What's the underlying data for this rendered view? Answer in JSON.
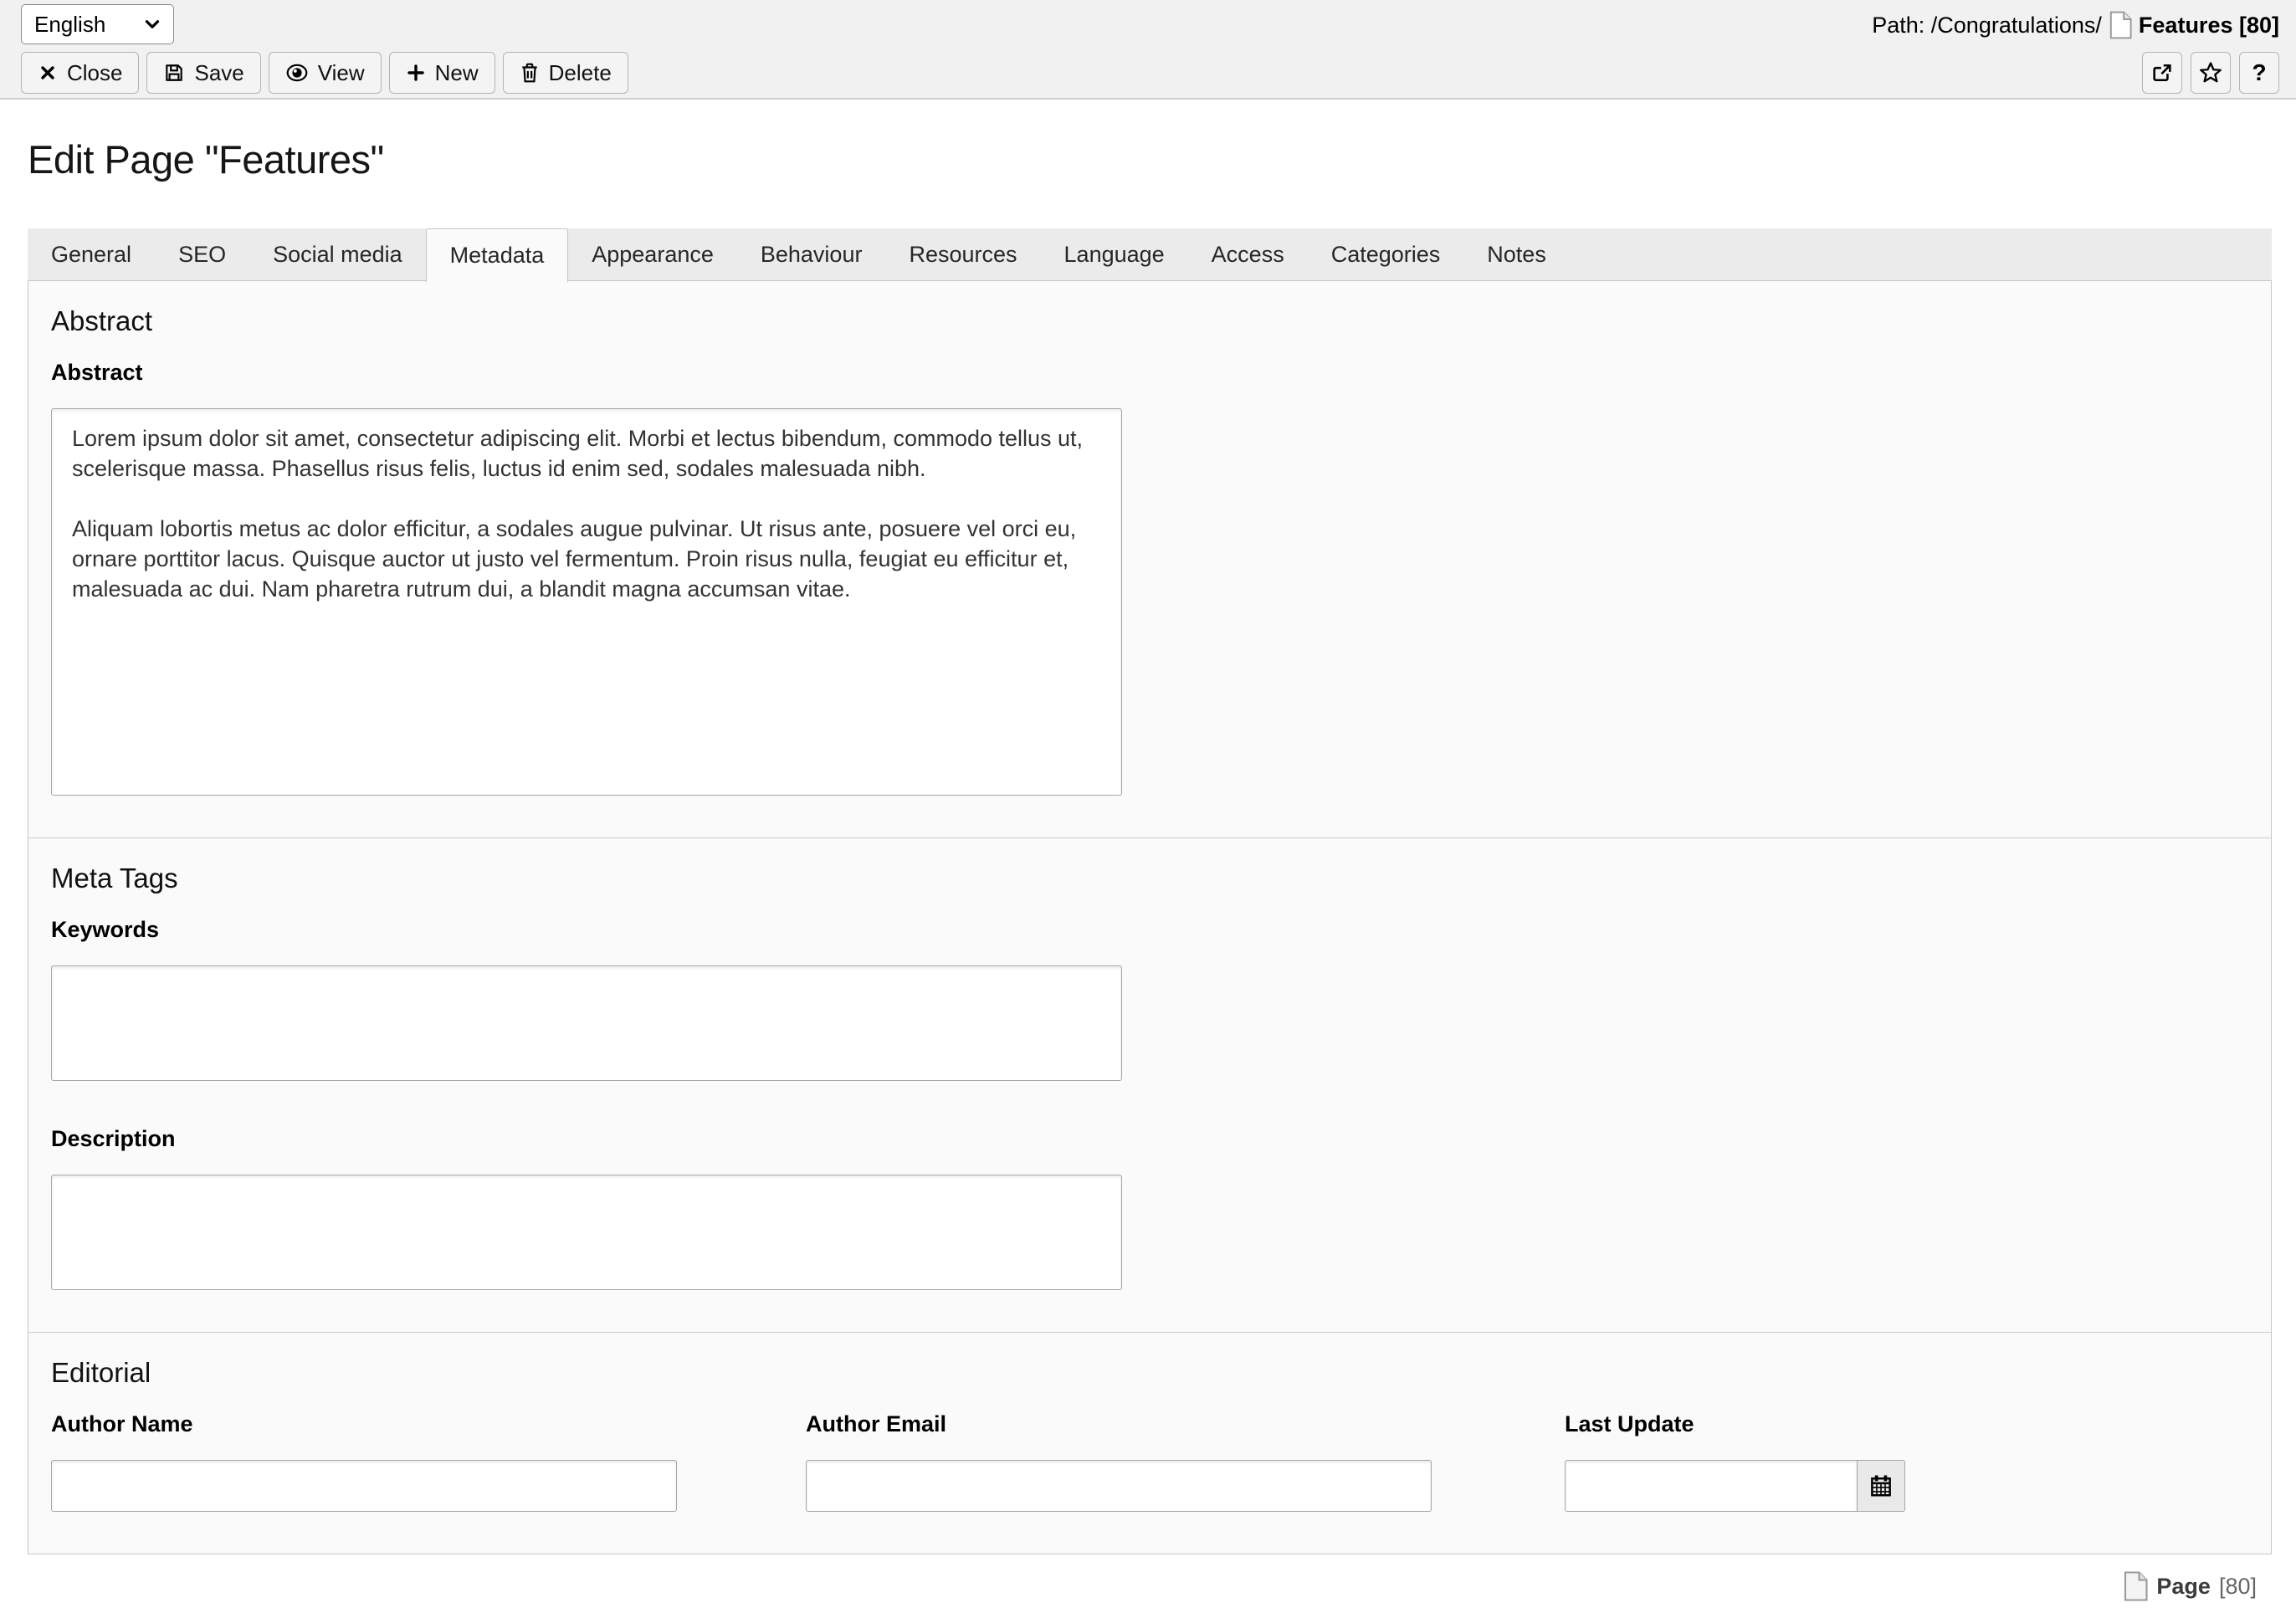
{
  "colors": {
    "toolbar_bg": "#f1f1f1",
    "panel_bg": "#fafafa",
    "border": "#c6c6c6"
  },
  "language_bar": {
    "selected_language": "English"
  },
  "toolbar": {
    "buttons": [
      {
        "label": "Close",
        "icon": "close-icon"
      },
      {
        "label": "Save",
        "icon": "save-icon"
      },
      {
        "label": "View",
        "icon": "view-icon"
      },
      {
        "label": "New",
        "icon": "new-icon"
      },
      {
        "label": "Delete",
        "icon": "delete-icon"
      }
    ]
  },
  "header": {
    "path_label": "Path: /Congratulations/",
    "record_icon": "page-icon",
    "record_title": "Features [80]",
    "icon_buttons": [
      {
        "name": "open-in-frontend",
        "icon": "external-link-icon",
        "label": ""
      },
      {
        "name": "bookmark",
        "icon": "star-icon",
        "label": ""
      },
      {
        "name": "help",
        "icon": "question-icon",
        "label": "?"
      }
    ]
  },
  "page": {
    "title": "Edit Page \"Features\""
  },
  "tabs": [
    {
      "label": "General",
      "active": false
    },
    {
      "label": "SEO",
      "active": false
    },
    {
      "label": "Social media",
      "active": false
    },
    {
      "label": "Metadata",
      "active": true
    },
    {
      "label": "Appearance",
      "active": false
    },
    {
      "label": "Behaviour",
      "active": false
    },
    {
      "label": "Resources",
      "active": false
    },
    {
      "label": "Language",
      "active": false
    },
    {
      "label": "Access",
      "active": false
    },
    {
      "label": "Categories",
      "active": false
    },
    {
      "label": "Notes",
      "active": false
    }
  ],
  "sections": {
    "abstract": {
      "heading": "Abstract",
      "field": {
        "label": "Abstract",
        "value": "Lorem ipsum dolor sit amet, consectetur adipiscing elit. Morbi et lectus bibendum, commodo tellus ut, scelerisque massa. Phasellus risus felis, luctus id enim sed, sodales malesuada nibh.\n\nAliquam lobortis metus ac dolor efficitur, a sodales augue pulvinar. Ut risus ante, posuere vel orci eu, ornare porttitor lacus. Quisque auctor ut justo vel fermentum. Proin risus nulla, feugiat eu efficitur et, malesuada ac dui. Nam pharetra rutrum dui, a blandit magna accumsan vitae."
      }
    },
    "meta_tags": {
      "heading": "Meta Tags",
      "keywords": {
        "label": "Keywords",
        "value": ""
      },
      "description": {
        "label": "Description",
        "value": ""
      }
    },
    "editorial": {
      "heading": "Editorial",
      "author_name": {
        "label": "Author Name",
        "value": ""
      },
      "author_email": {
        "label": "Author Email",
        "value": ""
      },
      "last_update": {
        "label": "Last Update",
        "value": ""
      }
    }
  },
  "footer": {
    "record_icon": "page-icon",
    "record_type": "Page",
    "record_uid": "[80]"
  }
}
